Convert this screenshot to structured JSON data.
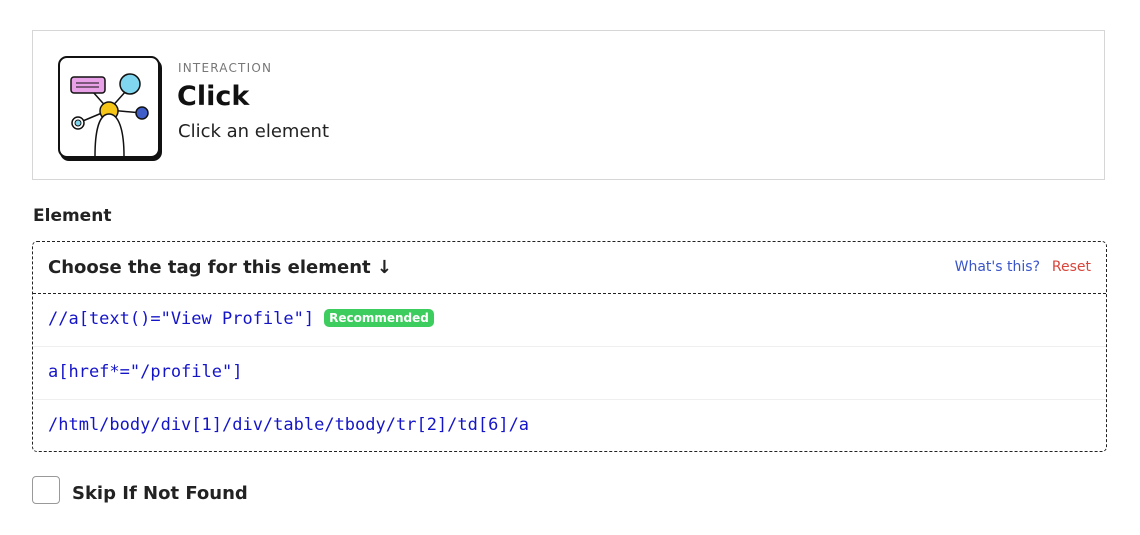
{
  "header": {
    "category": "INTERACTION",
    "title": "Click",
    "subtitle": "Click an element",
    "icon": "interaction-illustration-icon"
  },
  "element_section": {
    "label": "Element",
    "chooser": {
      "heading": "Choose the tag for this element ↓",
      "help_link": "What's this?",
      "reset_link": "Reset"
    },
    "options": [
      {
        "selector": "//a[text()=\"View Profile\"]",
        "badge": "Recommended"
      },
      {
        "selector": "a[href*=\"/profile\"]"
      },
      {
        "selector": "/html/body/div[1]/div/table/tbody/tr[2]/td[6]/a"
      }
    ]
  },
  "skip_option": {
    "label": "Skip If Not Found",
    "checked": false
  },
  "colors": {
    "link": "#3a55c8",
    "reset": "#d9453a",
    "code": "#1515c8",
    "badge": "#3dcc5e"
  }
}
